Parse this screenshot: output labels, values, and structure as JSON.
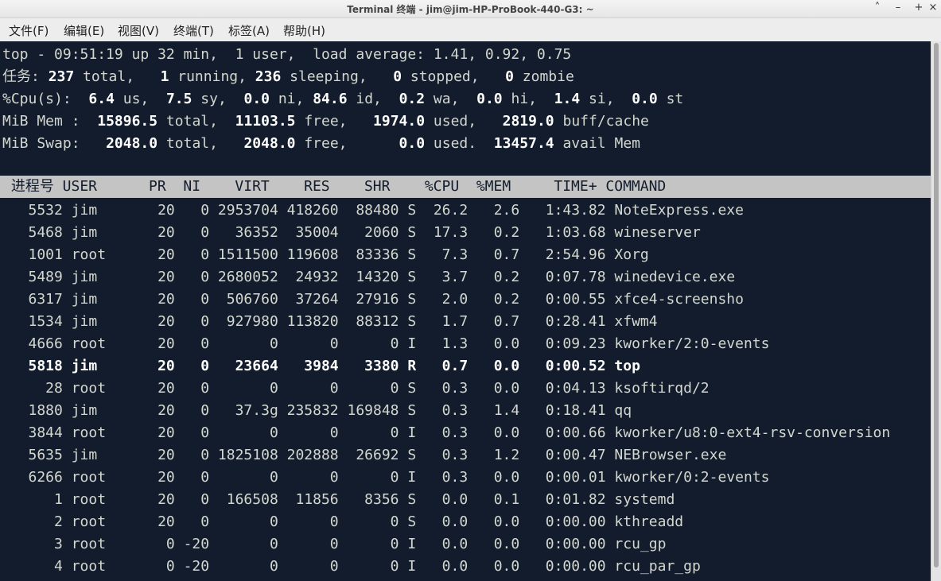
{
  "window": {
    "title": "Terminal 终端 - jim@jim-HP-ProBook-440-G3: ~",
    "buttons": {
      "up": "˄",
      "minimize": "–",
      "maximize": "+",
      "close": "×"
    }
  },
  "menu": [
    {
      "label": "文件(F)"
    },
    {
      "label": "编辑(E)"
    },
    {
      "label": "视图(V)"
    },
    {
      "label": "终端(T)"
    },
    {
      "label": "标签(A)"
    },
    {
      "label": "帮助(H)"
    }
  ],
  "summary": {
    "line1": "top - 09:51:19 up 32 min,  1 user,  load average: 1.41, 0.92, 0.75",
    "tasks": {
      "label": "任务:",
      "total": "237",
      "running": "1",
      "sleeping": "236",
      "stopped": "0",
      "zombie": "0"
    },
    "cpu": {
      "label": "%Cpu(s):",
      "us": "6.4",
      "sy": "7.5",
      "ni": "0.0",
      "id": "84.6",
      "wa": "0.2",
      "hi": "0.0",
      "si": "1.4",
      "st": "0.0"
    },
    "mem": {
      "label": "MiB Mem :",
      "total": "15896.5",
      "free": "11103.5",
      "used": "1974.0",
      "buff": "2819.0"
    },
    "swap": {
      "label": "MiB Swap:",
      "total": "2048.0",
      "free": "2048.0",
      "used": "0.0",
      "avail": "13457.4"
    }
  },
  "table": {
    "header": " 进程号 USER      PR  NI    VIRT    RES    SHR    %CPU  %MEM     TIME+ COMMAND",
    "rows": [
      {
        "text": "   5532 jim       20   0 2953704 418260  88480 S  26.2   2.6   1:43.82 NoteExpress.exe",
        "bold": false
      },
      {
        "text": "   5468 jim       20   0   36352  35004   2060 S  17.3   0.2   1:03.68 wineserver",
        "bold": false
      },
      {
        "text": "   1001 root      20   0 1511500 119608  83336 S   7.3   0.7   2:54.96 Xorg",
        "bold": false
      },
      {
        "text": "   5489 jim       20   0 2680052  24932  14320 S   3.7   0.2   0:07.78 winedevice.exe",
        "bold": false
      },
      {
        "text": "   6317 jim       20   0  506760  37264  27916 S   2.0   0.2   0:00.55 xfce4-screensho",
        "bold": false
      },
      {
        "text": "   1534 jim       20   0  927980 113820  88312 S   1.7   0.7   0:28.41 xfwm4",
        "bold": false
      },
      {
        "text": "   4666 root      20   0       0      0      0 I   1.3   0.0   0:09.23 kworker/2:0-events",
        "bold": false
      },
      {
        "text": "   5818 jim       20   0   23664   3984   3380 R   0.7   0.0   0:00.52 top",
        "bold": true
      },
      {
        "text": "     28 root      20   0       0      0      0 S   0.3   0.0   0:04.13 ksoftirqd/2",
        "bold": false
      },
      {
        "text": "   1880 jim       20   0   37.3g 235832 169848 S   0.3   1.4   0:18.41 qq",
        "bold": false
      },
      {
        "text": "   3844 root      20   0       0      0      0 I   0.3   0.0   0:00.66 kworker/u8:0-ext4-rsv-conversion",
        "bold": false
      },
      {
        "text": "   5635 jim       20   0 1825108 202888  26692 S   0.3   1.2   0:00.47 NEBrowser.exe",
        "bold": false
      },
      {
        "text": "   6266 root      20   0       0      0      0 I   0.3   0.0   0:00.01 kworker/0:2-events",
        "bold": false
      },
      {
        "text": "      1 root      20   0  166508  11856   8356 S   0.0   0.1   0:01.82 systemd",
        "bold": false
      },
      {
        "text": "      2 root      20   0       0      0      0 S   0.0   0.0   0:00.00 kthreadd",
        "bold": false
      },
      {
        "text": "      3 root       0 -20       0      0      0 I   0.0   0.0   0:00.00 rcu_gp",
        "bold": false
      },
      {
        "text": "      4 root       0 -20       0      0      0 I   0.0   0.0   0:00.00 rcu_par_gp",
        "bold": false
      }
    ]
  },
  "colors": {
    "terminal_bg": "#131c2c",
    "terminal_fg": "#d3d7cf",
    "header_bar": "#c4c4c4"
  }
}
